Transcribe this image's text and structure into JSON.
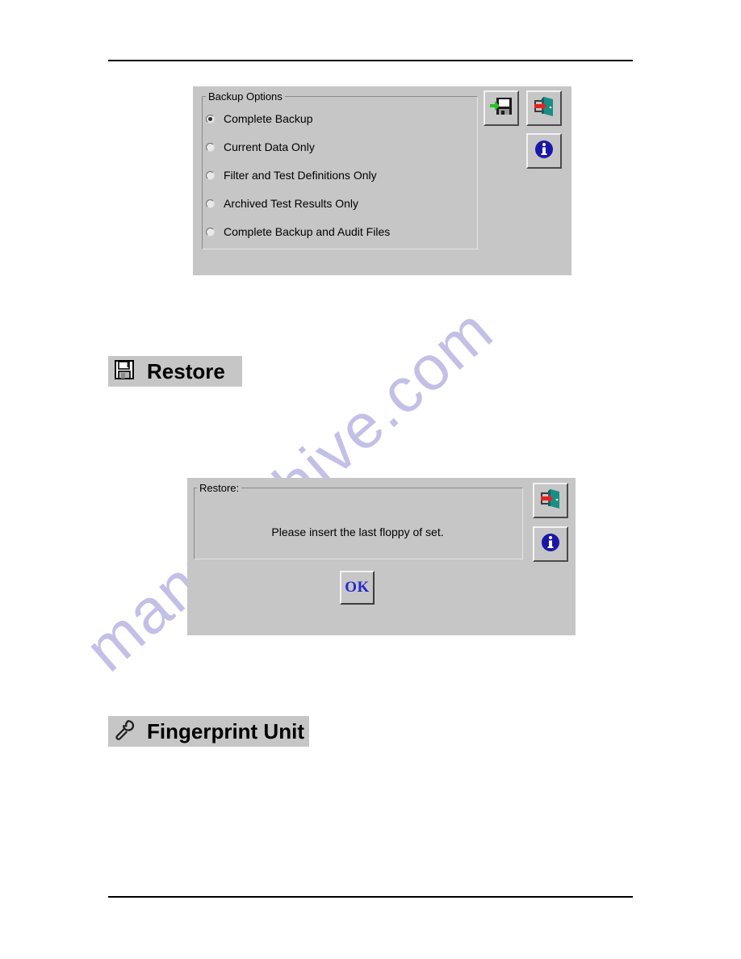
{
  "document": {
    "watermark": "manualshive.com"
  },
  "backup_dialog": {
    "group_title": "Backup Options",
    "options": [
      {
        "label": "Complete Backup",
        "selected": true
      },
      {
        "label": "Current Data Only",
        "selected": false
      },
      {
        "label": "Filter and Test Definitions Only",
        "selected": false
      },
      {
        "label": "Archived Test Results Only",
        "selected": false
      },
      {
        "label": "Complete Backup and Audit Files",
        "selected": false
      }
    ],
    "buttons": [
      {
        "name": "save-button",
        "icon": "save-floppy-icon"
      },
      {
        "name": "exit-button",
        "icon": "exit-door-icon"
      },
      {
        "name": "info-button",
        "icon": "info-icon"
      }
    ]
  },
  "restore_section": {
    "banner_label": "Restore",
    "banner_icon": "floppy-disk-icon"
  },
  "restore_dialog": {
    "group_title": "Restore:",
    "message": "Please insert the last floppy of set.",
    "ok_label": "OK",
    "buttons": [
      {
        "name": "exit-button",
        "icon": "exit-door-icon"
      },
      {
        "name": "info-button",
        "icon": "info-icon"
      }
    ]
  },
  "fingerprint_section": {
    "banner_label": "Fingerprint Unit",
    "banner_icon": "wrench-icon"
  },
  "colors": {
    "dialog_face": "#c6c6c6",
    "ok_text": "#2727cf",
    "info_blue": "#1a17a8",
    "door_teal": "#1a8d86",
    "arrow_red": "#e02424",
    "arrow_green": "#27c02b",
    "watermark": "#c3c0e8"
  }
}
